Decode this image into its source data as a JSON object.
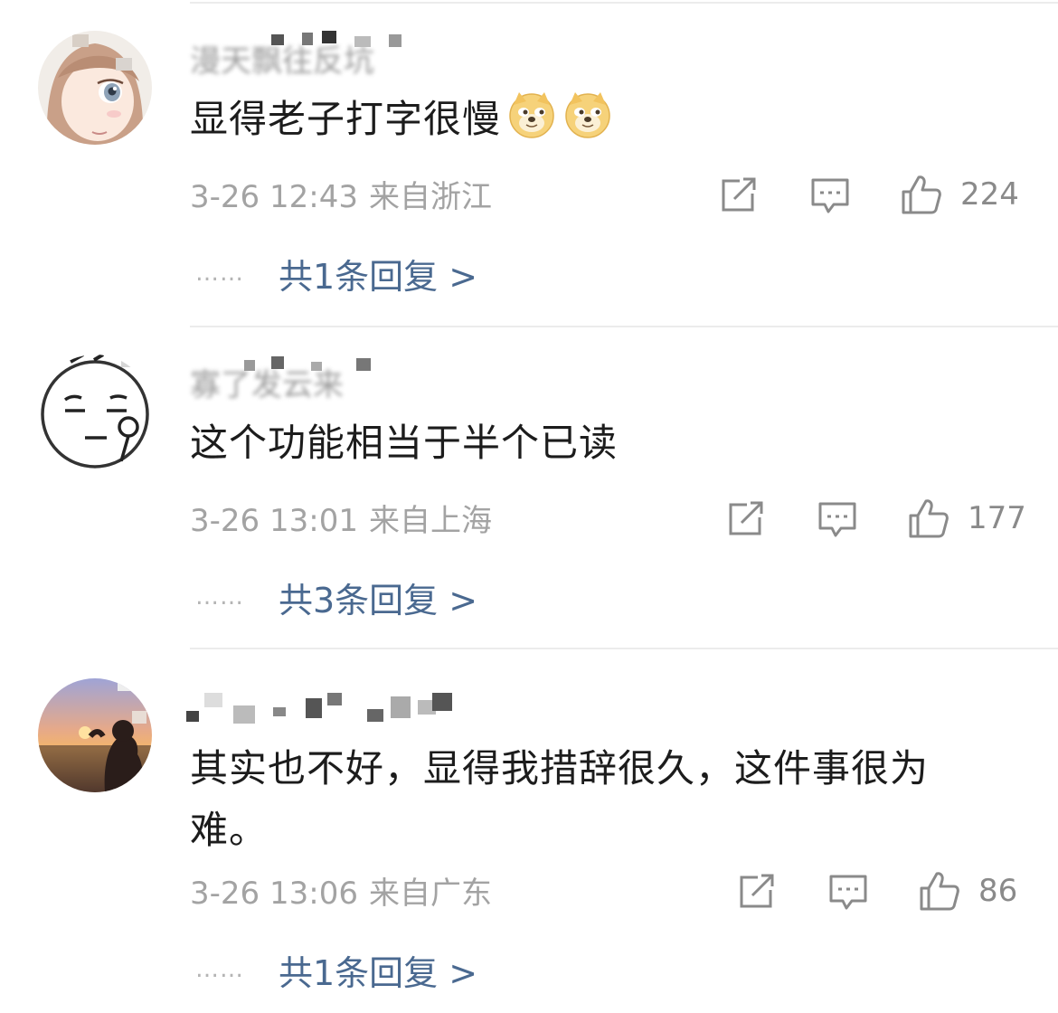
{
  "comments": [
    {
      "username": "漫天飘往反坑",
      "text": "显得老子打字很慢",
      "emojis": [
        "doge-emoji",
        "doge-emoji"
      ],
      "time": "3-26 12:43",
      "location": "来自浙江",
      "likes": "224",
      "reply_link": "共1条回复 >"
    },
    {
      "username": "寡了发云来",
      "text": "这个功能相当于半个已读",
      "emojis": [],
      "time": "3-26 13:01",
      "location": "来自上海",
      "likes": "177",
      "reply_link": "共3条回复 >"
    },
    {
      "username": "",
      "text": "其实也不好，显得我措辞很久，这件事很为难。",
      "emojis": [],
      "time": "3-26 13:06",
      "location": "来自广东",
      "likes": "86",
      "reply_link": "共1条回复 >"
    }
  ],
  "icons": {
    "repost": "share-square-icon",
    "comment": "comment-bubble-icon",
    "like": "thumbs-up-icon"
  },
  "colors": {
    "link": "#4a6990",
    "meta": "#a3a3a3",
    "text": "#1c1c1c",
    "icon": "#8a8a8a"
  },
  "reply_dots": "……"
}
